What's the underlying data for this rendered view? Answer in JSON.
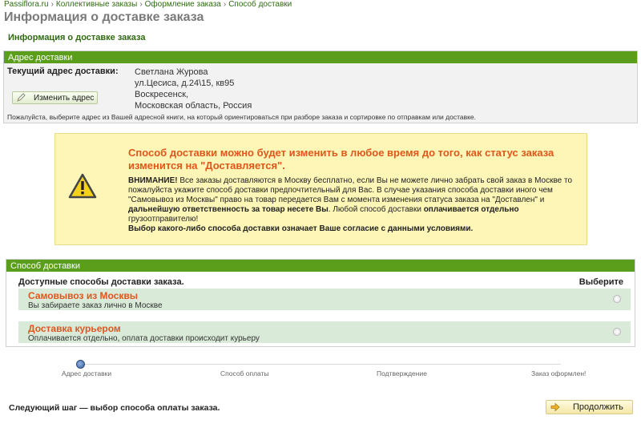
{
  "breadcrumb": {
    "items": [
      "Passiflora.ru",
      "Коллективные заказы",
      "Оформление заказа",
      "Способ доставки"
    ],
    "separator": "›"
  },
  "page_title": "Информация о доставке заказа",
  "subtitle": "Информация о доставке заказа",
  "address": {
    "header": "Адрес доставки",
    "label": "Текущий адрес доставки:",
    "lines": [
      "Светлана Журова",
      "ул.Цесиса, д.24\\15, кв95",
      "Воскресенск,",
      "Московская область, Россия"
    ],
    "change_button": "Изменить адрес",
    "note": "Пожалуйста, выберите адрес из Вашей адресной книги, на который ориентироваться при разборе заказа и сортировке по отправкам или доставке."
  },
  "warning": {
    "icon": "warning-icon",
    "title": "Способ доставки можно будет изменить в любое время до того, как статус заказа изменится на \"Доставляется\".",
    "attention": "ВНИМАНИЕ!",
    "text1": " Все заказы доставляются в Москву бесплатно, если Вы не можете лично забрать свой заказ в Москве то пожалуйста укажите способ доставки предпочтительный для Вас. В случае указания способа доставки иного чем \"Самовывоз из Москвы\" право на товар передается Вам с момента изменения статуса заказа на \"Доставлен\" и ",
    "bold1": "дальнейшую ответственность за товар несете Вы",
    "text2": ". Любой способ доставки ",
    "bold2": "оплачивается отдельно",
    "text3": " грузоотправителю!",
    "bold3": "Выбор какого-либо способа доставки означает Ваше согласие с данными условиями."
  },
  "delivery": {
    "header": "Способ доставки",
    "available_label": "Доступные способы доставки заказа.",
    "choose_label": "Выберите",
    "options": [
      {
        "title": "Самовывоз из Москвы",
        "description": "Вы забираете заказ лично в Москве"
      },
      {
        "title": "Доставка курьером",
        "description": "Оплачивается отдельно, оплата доставки происходит курьеру"
      }
    ]
  },
  "progress": {
    "steps": [
      "Адрес доставки",
      "Способ оплаты",
      "Подтверждение",
      "Заказ оформлен!"
    ],
    "current_step": 1
  },
  "footer": {
    "next_step": "Следующий шаг — выбор способа оплаты заказа.",
    "continue_button": "Продолжить"
  },
  "colors": {
    "brand_green": "#5a9e1b",
    "accent_orange": "#e0561b",
    "warning_bg": "#fdf6b6",
    "option_bg": "#d9ead9"
  }
}
